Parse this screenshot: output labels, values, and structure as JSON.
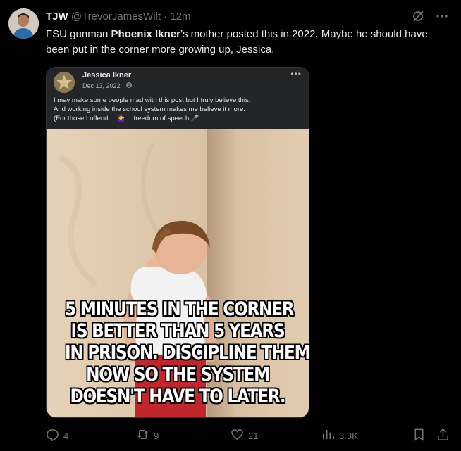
{
  "tweet": {
    "author_name": "TJW",
    "handle": "@TrevorJamesWilt",
    "separator": "·",
    "time": "12m",
    "text_before": "FSU gunman ",
    "text_bold": "Phoenix Ikner",
    "text_after": "’s mother posted this in 2022. Maybe he should have been put in the corner more growing up, Jessica."
  },
  "embedded_post": {
    "author": "Jessica Ikner",
    "date": "Dec 13, 2022 · ",
    "more": "•••",
    "line1": "I may make some people mad with this post but I truly believe this.",
    "line2": "And working inside the school system makes me believe it more.",
    "line3": "(For those I offend… 🤷‍♀️… freedom of speech 🎤"
  },
  "meme": {
    "lines": [
      "5 MINUTES IN THE CORNER",
      "IS BETTER THAN 5 YEARS",
      "IN PRISON. DISCIPLINE THEM",
      "NOW SO THE SYSTEM",
      "DOESN'T HAVE TO LATER."
    ]
  },
  "actions": {
    "replies": "4",
    "reposts": "9",
    "likes": "21",
    "views": "3.3K"
  },
  "colors": {
    "background": "#000000",
    "text": "#e7e9ea",
    "muted": "#71767b",
    "fb_card": "#242526"
  },
  "icons": [
    "grok-icon",
    "more-icon",
    "reply-icon",
    "repost-icon",
    "like-icon",
    "views-icon",
    "bookmark-icon",
    "share-icon"
  ]
}
